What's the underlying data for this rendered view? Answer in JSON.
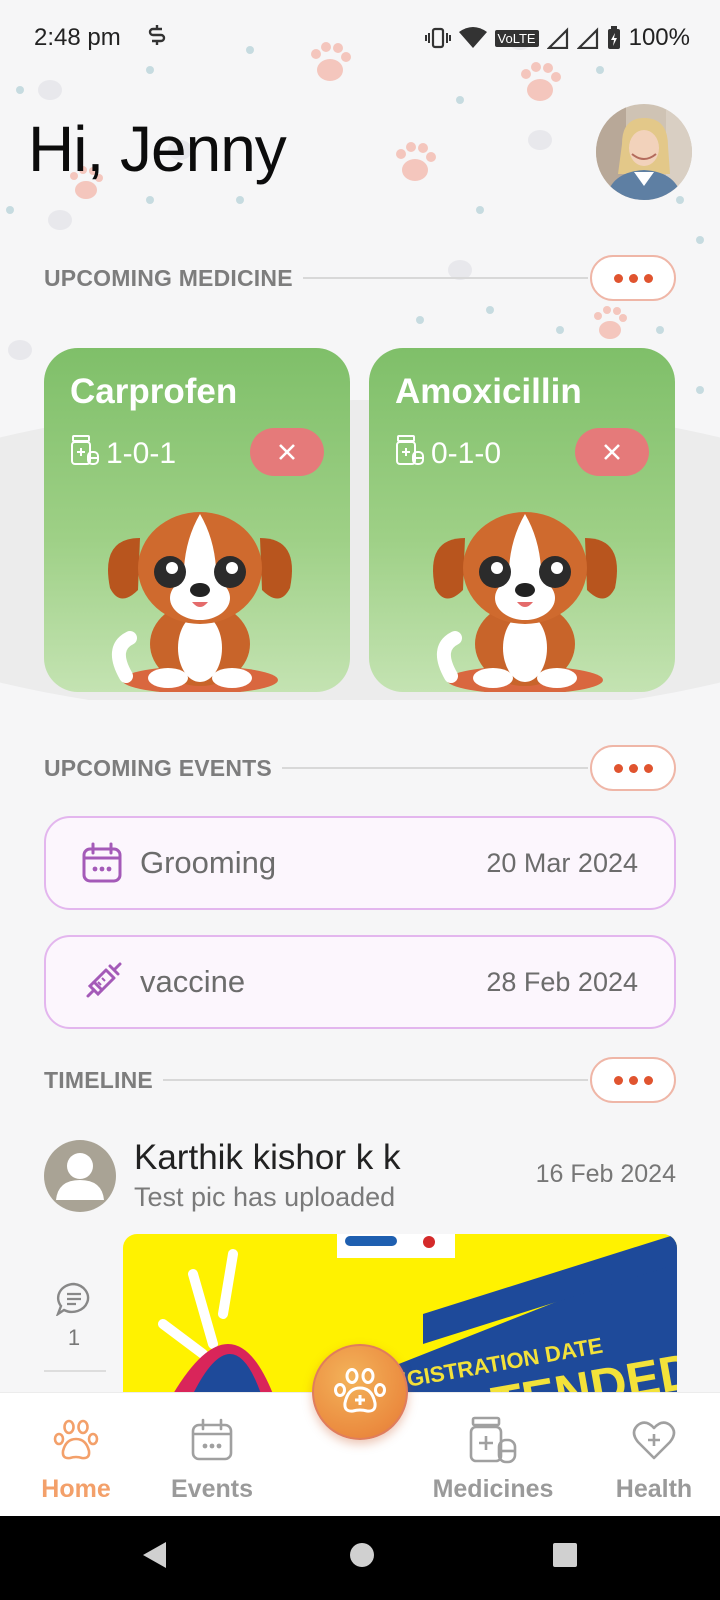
{
  "status_bar": {
    "time": "2:48 pm",
    "battery": "100%",
    "network_label": "VoLTE"
  },
  "header": {
    "greeting": "Hi, Jenny"
  },
  "sections": {
    "medicine_title": "UPCOMING MEDICINE",
    "events_title": "UPCOMING EVENTS",
    "timeline_title": "TIMELINE"
  },
  "medicines": [
    {
      "name": "Carprofen",
      "dose": "1-0-1"
    },
    {
      "name": "Amoxicillin",
      "dose": "0-1-0"
    }
  ],
  "events": [
    {
      "name": "Grooming",
      "date": "20 Mar 2024",
      "icon": "calendar-icon"
    },
    {
      "name": "vaccine",
      "date": "28 Feb 2024",
      "icon": "syringe-icon"
    }
  ],
  "timeline": {
    "author": "Karthik kishor k k",
    "description": "Test pic has uploaded",
    "date": "16 Feb 2024",
    "comment_count": "1",
    "image_text": "ENTS REGISTRATION DATE",
    "image_text_2": "TENDED"
  },
  "bottom_nav": {
    "items": [
      {
        "label": "Home",
        "icon": "paw-icon",
        "active": true
      },
      {
        "label": "Events",
        "icon": "calendar-icon",
        "active": false
      },
      {
        "label": "Medicines",
        "icon": "medicine-icon",
        "active": false
      },
      {
        "label": "Health",
        "icon": "heart-icon",
        "active": false
      }
    ],
    "fab_icon": "paw-plus-icon"
  },
  "colors": {
    "accent": "#f3a06a",
    "card_green": "#7fbf69",
    "close_red": "#e57a7a",
    "event_border": "#e3b6ee",
    "dots": "#e0542f"
  }
}
